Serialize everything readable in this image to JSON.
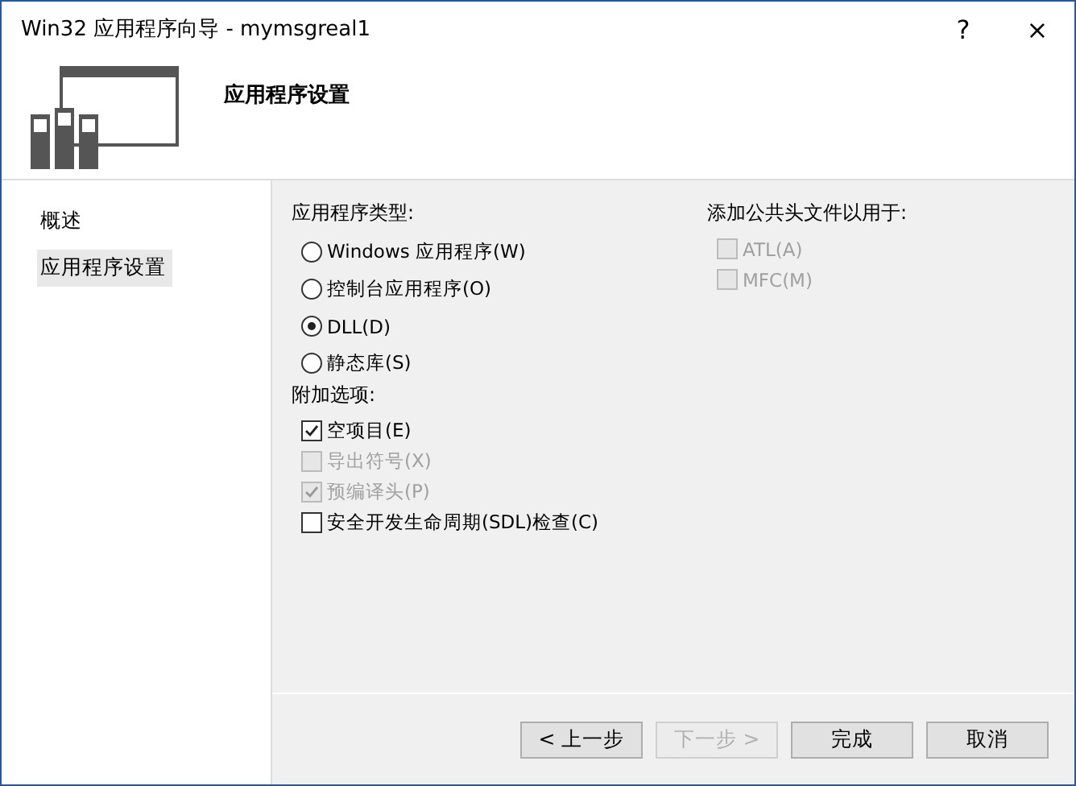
{
  "window": {
    "title": "Win32 应用程序向导 - mymsgreal1",
    "help": "?",
    "close": "×"
  },
  "header": {
    "title": "应用程序设置"
  },
  "sidebar": {
    "items": [
      {
        "label": "概述",
        "selected": false
      },
      {
        "label": "应用程序设置",
        "selected": true
      }
    ]
  },
  "app_type": {
    "label": "应用程序类型:",
    "options": [
      {
        "label": "Windows 应用程序(W)",
        "selected": false
      },
      {
        "label": "控制台应用程序(O)",
        "selected": false
      },
      {
        "label": "DLL(D)",
        "selected": true
      },
      {
        "label": "静态库(S)",
        "selected": false
      }
    ]
  },
  "extra_options": {
    "label": "附加选项:",
    "options": [
      {
        "label": "空项目(E)",
        "checked": true,
        "disabled": false
      },
      {
        "label": "导出符号(X)",
        "checked": false,
        "disabled": true
      },
      {
        "label": "预编译头(P)",
        "checked": true,
        "disabled": true
      },
      {
        "label": "安全开发生命周期(SDL)检查(C)",
        "checked": false,
        "disabled": false
      }
    ]
  },
  "common_headers": {
    "label": "添加公共头文件以用于:",
    "options": [
      {
        "label": "ATL(A)",
        "checked": false,
        "disabled": true
      },
      {
        "label": "MFC(M)",
        "checked": false,
        "disabled": true
      }
    ]
  },
  "buttons": [
    {
      "label": "< 上一步",
      "disabled": false
    },
    {
      "label": "下一步 >",
      "disabled": true
    },
    {
      "label": "完成",
      "disabled": false
    },
    {
      "label": "取消",
      "disabled": false
    }
  ]
}
